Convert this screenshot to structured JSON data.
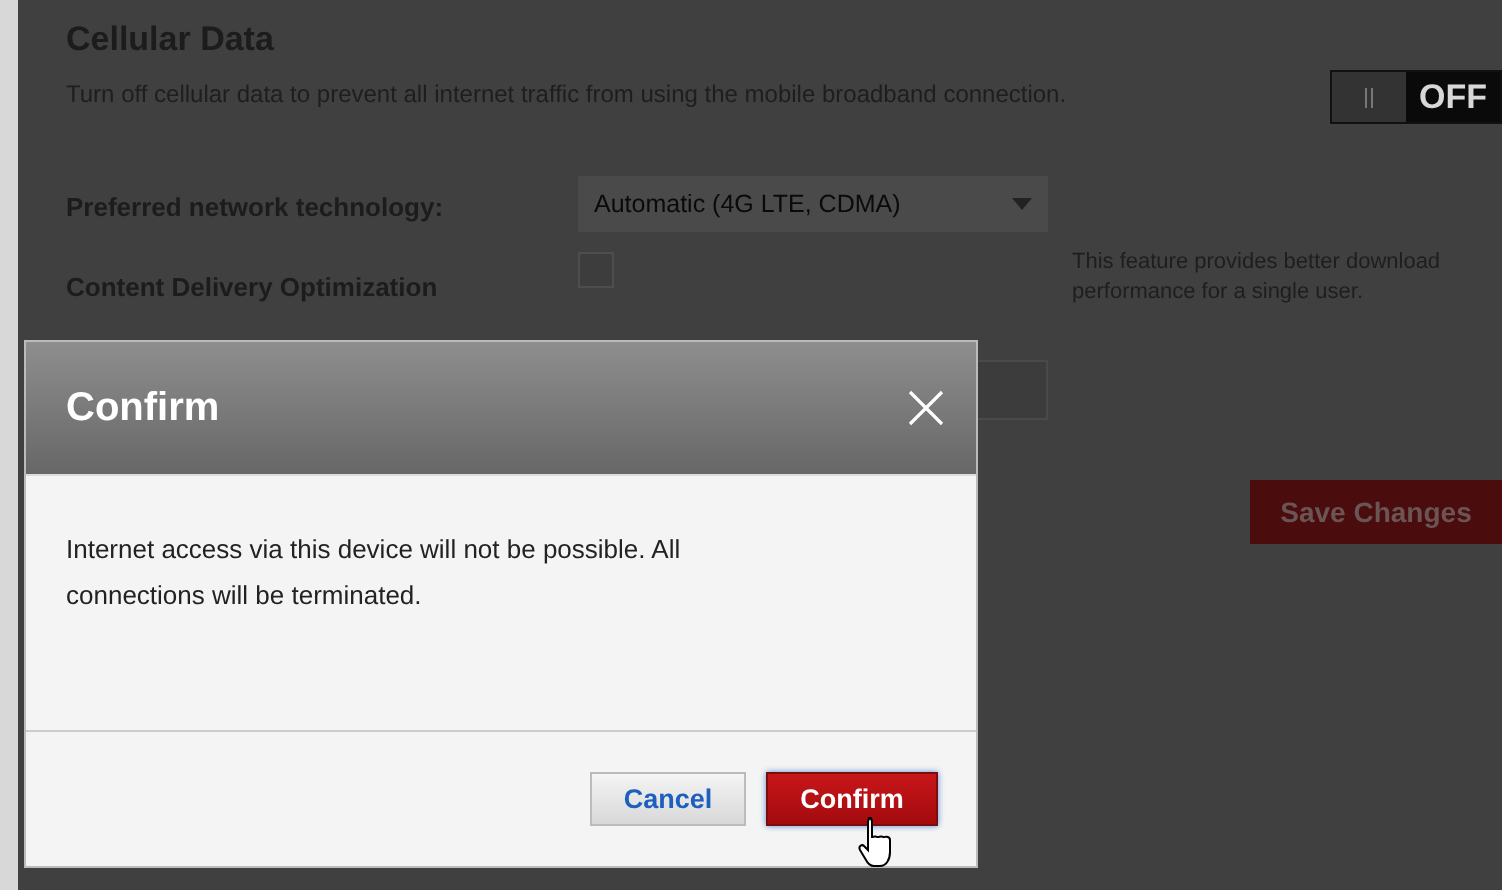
{
  "section": {
    "title": "Cellular Data",
    "description": "Turn off cellular data to prevent all internet traffic from using the mobile broadband connection.",
    "toggle": {
      "label": "OFF",
      "on": false
    }
  },
  "settings": [
    {
      "kind": "select",
      "label": "Preferred network technology:",
      "value": "Automatic (4G LTE, CDMA)"
    },
    {
      "kind": "checkbox",
      "label": "Content Delivery Optimization",
      "checked": false,
      "note": "This feature provides better download performance for a single user."
    },
    {
      "kind": "field"
    }
  ],
  "save_button": "Save Changes",
  "dialog": {
    "title": "Confirm",
    "message": "Internet access via this device will not be possible. All connections will be terminated.",
    "buttons": [
      {
        "label": "Cancel",
        "kind": "secondary"
      },
      {
        "label": "Confirm",
        "kind": "primary"
      }
    ]
  }
}
